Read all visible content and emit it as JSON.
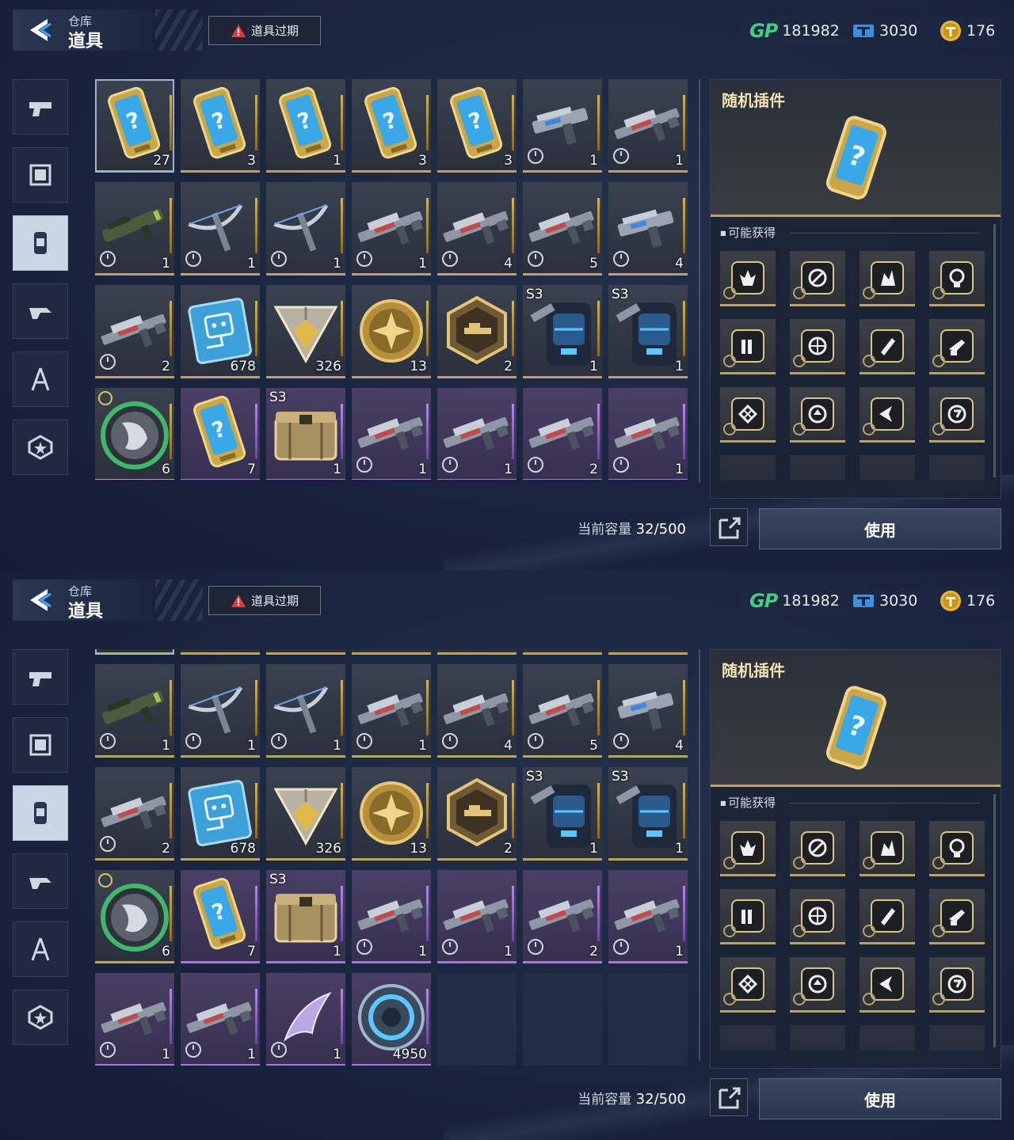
{
  "header": {
    "sub": "仓库",
    "title": "道具",
    "expire_button": "道具过期"
  },
  "currency": {
    "gp_label": "GP",
    "gp_value": "181982",
    "ticket_value": "3030",
    "coin_value": "176"
  },
  "nav_icons": [
    "pistol-icon",
    "frame-icon",
    "canister-icon",
    "mech-icon",
    "compass-icon",
    "star-badge-icon"
  ],
  "capacity": {
    "label": "当前容量",
    "value": "32/500"
  },
  "panel": {
    "item_name": "随机插件",
    "obtain_label": "可能获得",
    "use_button": "使用"
  },
  "items": [
    {
      "icon": "chip-card",
      "qty": "27",
      "tier": "gold",
      "tag": "",
      "timed": false,
      "selected": true
    },
    {
      "icon": "chip-card",
      "qty": "3",
      "tier": "gold",
      "tag": "",
      "timed": false
    },
    {
      "icon": "chip-card",
      "qty": "1",
      "tier": "gold",
      "tag": "",
      "timed": false
    },
    {
      "icon": "chip-card",
      "qty": "3",
      "tier": "gold",
      "tag": "",
      "timed": false
    },
    {
      "icon": "chip-card",
      "qty": "3",
      "tier": "gold",
      "tag": "",
      "timed": false
    },
    {
      "icon": "pistol",
      "qty": "1",
      "tier": "gold",
      "tag": "",
      "timed": true
    },
    {
      "icon": "rifle",
      "qty": "1",
      "tier": "gold",
      "tag": "",
      "timed": true
    },
    {
      "icon": "launcher",
      "qty": "1",
      "tier": "gold",
      "tag": "",
      "timed": true
    },
    {
      "icon": "crossbow",
      "qty": "1",
      "tier": "gold",
      "tag": "",
      "timed": true
    },
    {
      "icon": "crossbow",
      "qty": "1",
      "tier": "gold",
      "tag": "",
      "timed": true
    },
    {
      "icon": "rifle",
      "qty": "1",
      "tier": "gold",
      "tag": "",
      "timed": true
    },
    {
      "icon": "rifle",
      "qty": "4",
      "tier": "gold",
      "tag": "",
      "timed": true
    },
    {
      "icon": "rifle",
      "qty": "5",
      "tier": "gold",
      "tag": "",
      "timed": true
    },
    {
      "icon": "pistol",
      "qty": "4",
      "tier": "gold",
      "tag": "",
      "timed": true
    },
    {
      "icon": "rifle",
      "qty": "2",
      "tier": "gold",
      "tag": "",
      "timed": true
    },
    {
      "icon": "circuit-chip",
      "qty": "678",
      "tier": "gold",
      "tag": "",
      "timed": false
    },
    {
      "icon": "triangle-crystal",
      "qty": "326",
      "tier": "gold",
      "tag": "",
      "timed": false
    },
    {
      "icon": "gold-medal",
      "qty": "13",
      "tier": "gold",
      "tag": "",
      "timed": false
    },
    {
      "icon": "hex-badge",
      "qty": "2",
      "tier": "gold",
      "tag": "",
      "timed": false
    },
    {
      "icon": "backpack",
      "qty": "1",
      "tier": "gold",
      "tag": "S3",
      "timed": false
    },
    {
      "icon": "backpack",
      "qty": "1",
      "tier": "gold",
      "tag": "S3",
      "timed": false
    },
    {
      "icon": "emblem",
      "qty": "6",
      "tier": "gold",
      "tag": "",
      "timed": false,
      "top_clock": true
    },
    {
      "icon": "chip-card",
      "qty": "7",
      "tier": "purple",
      "tag": "",
      "timed": false
    },
    {
      "icon": "crate",
      "qty": "1",
      "tier": "purple",
      "tag": "S3",
      "timed": false
    },
    {
      "icon": "rifle",
      "qty": "1",
      "tier": "purple",
      "tag": "",
      "timed": true
    },
    {
      "icon": "rifle",
      "qty": "1",
      "tier": "purple",
      "tag": "",
      "timed": true
    },
    {
      "icon": "rifle",
      "qty": "2",
      "tier": "purple",
      "tag": "",
      "timed": true
    },
    {
      "icon": "rifle",
      "qty": "1",
      "tier": "purple",
      "tag": "",
      "timed": true
    },
    {
      "icon": "rifle",
      "qty": "1",
      "tier": "purple",
      "tag": "",
      "timed": true
    },
    {
      "icon": "rifle",
      "qty": "1",
      "tier": "purple",
      "tag": "",
      "timed": true
    },
    {
      "icon": "blade",
      "qty": "1",
      "tier": "purple",
      "tag": "",
      "timed": true
    },
    {
      "icon": "ring-token",
      "qty": "4950",
      "tier": "purple",
      "tag": "",
      "timed": false
    }
  ],
  "plugins": [
    "bullet-wings-plugin-icon",
    "no-fire-plugin-icon",
    "flame-plugin-icon",
    "target-plugin-icon",
    "ammo-plugin-icon",
    "crosshair-plugin-icon",
    "missile-plugin-icon",
    "gun-plugin-icon",
    "shield-plugin-icon",
    "up-arrow-plugin-icon",
    "wing-plugin-icon",
    "swap-plugin-icon"
  ],
  "colors": {
    "gold": "#b8a46a",
    "purple": "#a27ad6",
    "gp": "#39d186",
    "bg": "#1b2640"
  }
}
